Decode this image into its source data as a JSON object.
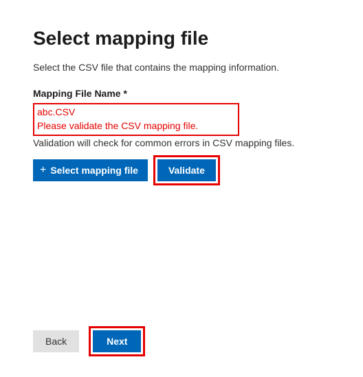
{
  "header": {
    "title": "Select mapping file",
    "description": "Select the CSV file that contains the mapping information."
  },
  "form": {
    "label": "Mapping File Name *",
    "file_name": "abc.CSV",
    "error_msg": "Please validate the CSV mapping file.",
    "hint": "Validation will check for common errors in CSV mapping files."
  },
  "buttons": {
    "select_label": "Select mapping file",
    "validate_label": "Validate",
    "back_label": "Back",
    "next_label": "Next"
  }
}
